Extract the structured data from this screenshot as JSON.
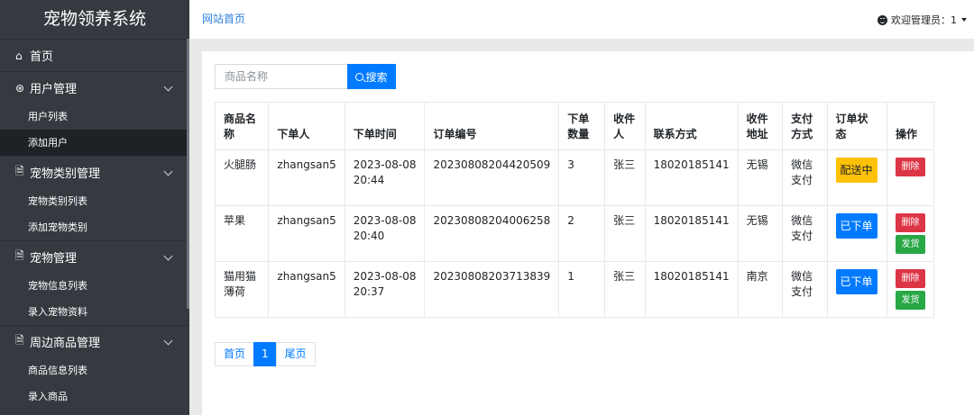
{
  "app_title": "宠物领养系统",
  "sidebar": {
    "home_label": "首页",
    "groups": [
      {
        "label": "用户管理",
        "items": [
          "用户列表",
          "添加用户"
        ]
      },
      {
        "label": "宠物类别管理",
        "items": [
          "宠物类别列表",
          "添加宠物类别"
        ]
      },
      {
        "label": "宠物管理",
        "items": [
          "宠物信息列表",
          "录入宠物资料"
        ]
      },
      {
        "label": "周边商品管理",
        "items": [
          "商品信息列表",
          "录入商品"
        ]
      }
    ]
  },
  "header": {
    "home_link": "网站首页",
    "welcome": "欢迎管理员：1"
  },
  "search": {
    "placeholder": "商品名称",
    "button_label": "搜索"
  },
  "table": {
    "headers": [
      "商品名称",
      "下单人",
      "下单时间",
      "订单编号",
      "下单数量",
      "收件人",
      "联系方式",
      "收件地址",
      "支付方式",
      "订单状态",
      "操作"
    ],
    "rows": [
      {
        "product": "火腿肠",
        "buyer": "zhangsan5",
        "time": "2023-08-08 20:44",
        "order_no": "20230808204420509",
        "qty": "3",
        "recipient": "张三",
        "phone": "18020185141",
        "address": "无锡",
        "payment": "微信支付",
        "status": "配送中",
        "status_color": "#ffc107",
        "actions": [
          "删除"
        ]
      },
      {
        "product": "苹果",
        "buyer": "zhangsan5",
        "time": "2023-08-08 20:40",
        "order_no": "20230808204006258",
        "qty": "2",
        "recipient": "张三",
        "phone": "18020185141",
        "address": "无锡",
        "payment": "微信支付",
        "status": "已下单",
        "status_color": "#007bff",
        "actions": [
          "删除",
          "发货"
        ]
      },
      {
        "product": "猫用猫薄荷",
        "buyer": "zhangsan5",
        "time": "2023-08-08 20:37",
        "order_no": "20230808203713839",
        "qty": "1",
        "recipient": "张三",
        "phone": "18020185141",
        "address": "南京",
        "payment": "微信支付",
        "status": "已下单",
        "status_color": "#007bff",
        "actions": [
          "删除",
          "发货"
        ]
      }
    ]
  },
  "pagination": {
    "first": "首页",
    "current": "1",
    "last": "尾页"
  }
}
